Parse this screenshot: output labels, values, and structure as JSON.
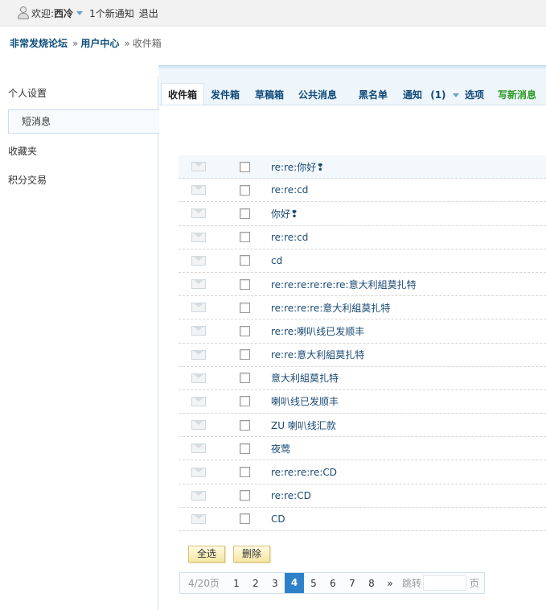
{
  "topbar": {
    "welcome": "欢迎:",
    "username": "西冷",
    "notice": "1个新通知",
    "logout": "退出"
  },
  "breadcrumb": {
    "forum": "非常发烧论坛",
    "sep": "»",
    "user_center": "用户中心",
    "current": "收件箱"
  },
  "sidebar": {
    "items": [
      "个人设置",
      "短消息",
      "收藏夹",
      "积分交易"
    ]
  },
  "tabs": {
    "inbox": "收件箱",
    "sent": "发件箱",
    "drafts": "草稿箱",
    "public": "公共消息",
    "blacklist": "黑名单",
    "notify": "通知",
    "notify_count": "(1)",
    "options": "选项",
    "compose": "写新消息"
  },
  "messages": [
    "re:re:你好❢",
    "re:re:cd",
    "你好❢",
    "re:re:cd",
    "cd",
    "re:re:re:re:re:re:意大利組莫扎特",
    "re:re:re:re:意大利組莫扎特",
    "re:re:喇叭线已发顺丰",
    "re:re:意大利組莫扎特",
    "意大利組莫扎特",
    "喇叭线已发顺丰",
    "ZU 喇叭线汇款",
    "夜莺",
    "re:re:re:re:CD",
    "re:re:CD",
    "CD"
  ],
  "buttons": {
    "select_all": "全选",
    "delete": "删除"
  },
  "pager": {
    "count": "4/20页",
    "pages": [
      "1",
      "2",
      "3",
      "4",
      "5",
      "6",
      "7",
      "8"
    ],
    "current": "4",
    "next": "»",
    "jump_label": "跳转",
    "unit": "页"
  }
}
